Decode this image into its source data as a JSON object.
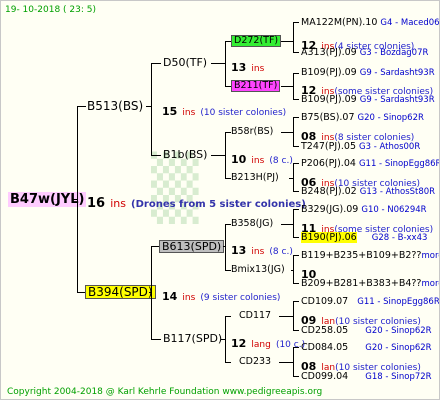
{
  "header": {
    "date": "19-  10-2018  (  23:   5)"
  },
  "footer": {
    "copyright": "Copyright 2004-2018 @ Karl Kehrle Foundation    www.pedigreeapis.org"
  },
  "colors": {
    "date_green": "#00a000",
    "ins_red": "#d00000",
    "note_blue": "#2222cc",
    "highlight_yellow": "#ffff00",
    "highlight_gray": "#bfbfbf",
    "highlight_green": "#33ee33",
    "highlight_pink": "#ff44ff",
    "root_bg": "#ffccff"
  },
  "root": {
    "name": "B47w(JYL)",
    "count": "16",
    "ins": "ins",
    "note": "(Drones from 5 sister colonies)"
  },
  "gen2": [
    {
      "name": "B513(BS)",
      "count": "15",
      "ins": "ins",
      "note": "(10 sister colonies)"
    },
    {
      "name": "B394(SPD)",
      "count": "14",
      "ins": "ins",
      "note": "(9 sister colonies)"
    }
  ],
  "gen3": [
    {
      "name": "D50(TF)",
      "count": "13",
      "ins": "ins",
      "note": ""
    },
    {
      "name": "B1b(BS)",
      "count": "10",
      "ins": "ins",
      "note": "(8 c.)"
    },
    {
      "name": "B613(SPD)",
      "count": "13",
      "ins": "ins",
      "note": "(8 c.)"
    },
    {
      "name": "B117(SPD)",
      "count": "12",
      "ins": "lang",
      "note": "(10 c.)"
    }
  ],
  "gen4": [
    {
      "name": "D272(TF)",
      "count": "12",
      "ins": "ins",
      "note": "(4 sister colonies)",
      "top": "MA122M(PN).10",
      "top_right": "G4 - Maced06Q",
      "bot": "A313(PJ).09",
      "bot_right": "G3 - Bozdag07R"
    },
    {
      "name": "B211(TF)",
      "count": "12",
      "ins": "ins",
      "note": "(some sister colonies)",
      "top": "B109(PJ).09",
      "top_right": "G9 - Sardasht93R",
      "bot": "B109(PJ).09",
      "bot_right": "G9 - Sardasht93R"
    },
    {
      "name": "B58r(BS)",
      "count": "08",
      "ins": "ins",
      "note": "(8 sister colonies)",
      "top": "B75(BS).07",
      "top_right": "G20 - Sinop62R",
      "bot": "T247(PJ).05",
      "bot_right": "G3 - Athos00R"
    },
    {
      "name": "B213H(PJ)",
      "count": "06",
      "ins": "ins",
      "note": "(10 sister colonies)",
      "top": "P206(PJ).04",
      "top_right": "G11 - SinopEgg86R",
      "bot": "B248(PJ).02",
      "bot_right": "G13 - AthosSt80R"
    },
    {
      "name": "B358(JG)",
      "count": "11",
      "ins": "ins",
      "note": "(some sister colonies)",
      "top": "B329(JG).09",
      "top_right": "G10 - N06294R",
      "bot": "B190(PJ).06",
      "bot_right": "G28 - B-xx43"
    },
    {
      "name": "Bmix13(JG)",
      "count": "10",
      "ins": "",
      "note": "",
      "top": "B119+B235+B109+B2??",
      "top_right": "more",
      "bot": "B209+B281+B383+B4??",
      "bot_right": "more"
    },
    {
      "name": "CD117",
      "count": "09",
      "ins": "lan",
      "note": "(10 sister colonies)",
      "top": "CD109.07",
      "top_right": "G11 - SinopEgg86R",
      "bot": "CD258.05",
      "bot_right": "G20 - Sinop62R"
    },
    {
      "name": "CD233",
      "count": "08",
      "ins": "lan",
      "note": "(10 sister colonies)",
      "top": "CD084.05",
      "top_right": "G20 - Sinop62R",
      "bot": "CD099.04",
      "bot_right": "G18 - Sinop72R"
    }
  ]
}
